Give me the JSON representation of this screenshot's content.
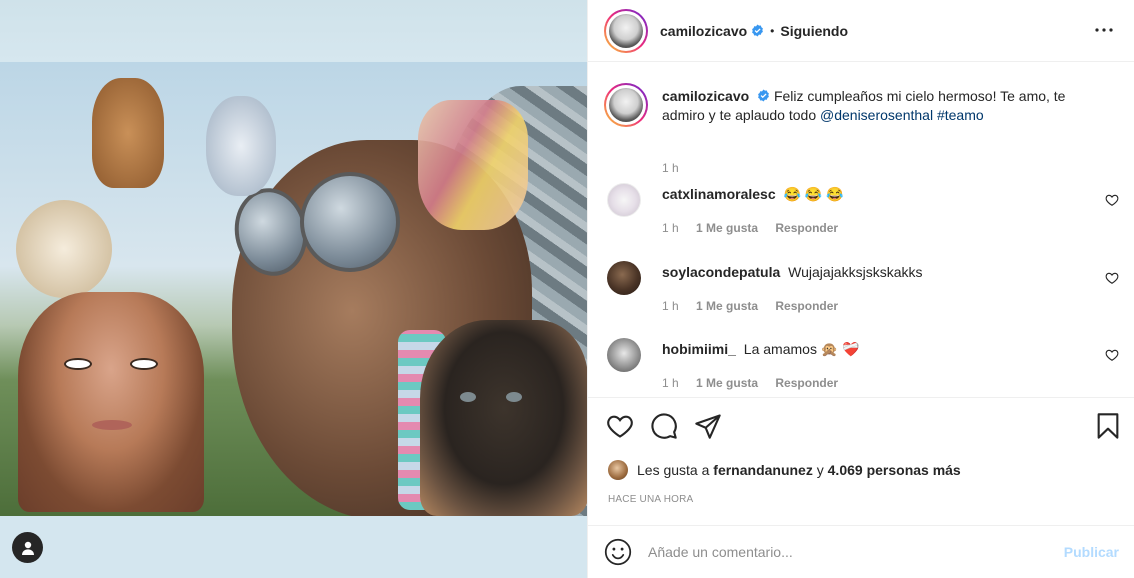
{
  "header": {
    "username": "camilozicavo",
    "separator": "•",
    "follow_status": "Siguiendo"
  },
  "caption": {
    "username": "camilozicavo",
    "text": "Feliz cumpleaños mi cielo hermoso! Te amo, te admiro y te aplaudo todo ",
    "mention": "@deniserosenthal",
    "hashtag": "#teamo",
    "time": "1 h"
  },
  "comments": [
    {
      "username": "catxlinamoralesc",
      "text": "😂 😂 😂",
      "time": "1 h",
      "likes": "1 Me gusta",
      "reply": "Responder"
    },
    {
      "username": "soylacondepatula",
      "text": "Wujajajakksjskskakks",
      "time": "1 h",
      "likes": "1 Me gusta",
      "reply": "Responder"
    },
    {
      "username": "hobimiimi_",
      "text": "La amamos 🙊 ❤️‍🩹",
      "time": "1 h",
      "likes": "1 Me gusta",
      "reply": "Responder"
    }
  ],
  "likes": {
    "prefix": "Les gusta a",
    "user": "fernandanunez",
    "joiner": "y",
    "others": "4.069 personas más"
  },
  "timestamp": "HACE UNA HORA",
  "composer": {
    "placeholder": "Añade un comentario...",
    "post_label": "Publicar"
  },
  "colors": {
    "verified": "#3897f0",
    "post_disabled": "#b3dbff",
    "muted": "#8e8e8e",
    "link": "#00376b"
  },
  "icons": [
    "verified-badge-icon",
    "more-options-icon",
    "heart-icon",
    "comment-icon",
    "share-icon",
    "bookmark-icon",
    "emoji-icon",
    "profile-icon"
  ]
}
